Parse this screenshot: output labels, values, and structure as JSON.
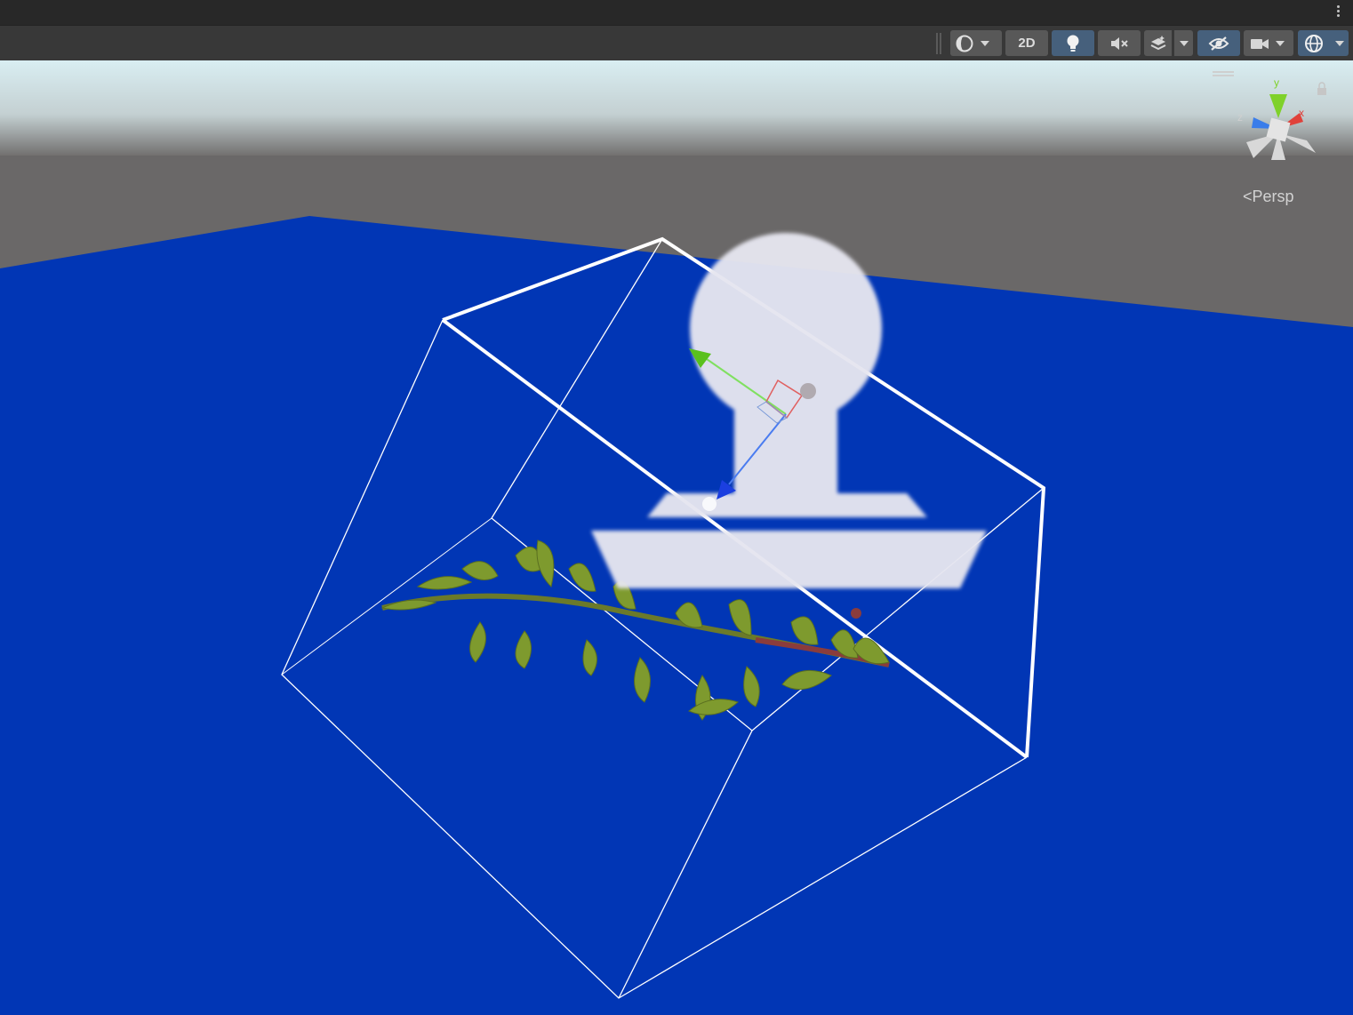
{
  "toolbar": {
    "shading_mode_icon": "shading-sphere-icon",
    "two_d_label": "2D",
    "lighting_icon": "lightbulb-icon",
    "audio_icon": "audio-mute-icon",
    "effects_icon": "effects-layers-icon",
    "hidden_objects_icon": "eye-slash-icon",
    "camera_icon": "camera-icon",
    "gizmos_icon": "gizmo-globe-icon"
  },
  "scene_gizmo": {
    "axis_y": "y",
    "axis_x": "x",
    "axis_z": "z",
    "projection_label": "Persp"
  },
  "colors": {
    "ground": "#0136b5",
    "horizon_gray": "#6a6868",
    "sky": "#d9eef2",
    "gizmo_x": "#e0413a",
    "gizmo_y": "#7fd12a",
    "gizmo_z": "#3a7dea",
    "toggle_active": "#46607c"
  }
}
